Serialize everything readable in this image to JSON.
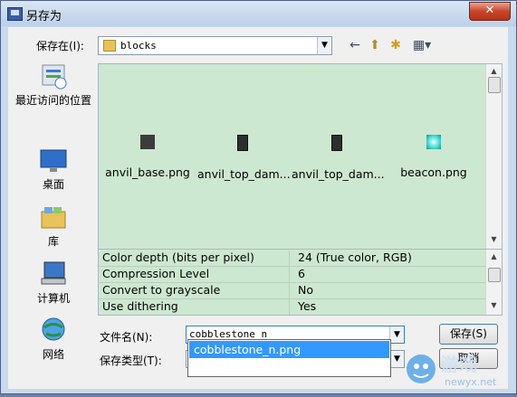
{
  "window": {
    "title": "另存为",
    "close_glyph": "✕"
  },
  "location": {
    "label": "保存在(I):",
    "folder": "blocks"
  },
  "toolbar": {
    "back": "←",
    "up": "⬆",
    "new_folder": "✱",
    "view": "▦▾"
  },
  "places": [
    {
      "label": "最近访问的位置",
      "icon": "recent-places-icon"
    },
    {
      "label": "桌面",
      "icon": "desktop-icon"
    },
    {
      "label": "库",
      "icon": "libraries-icon"
    },
    {
      "label": "计算机",
      "icon": "computer-icon"
    },
    {
      "label": "网络",
      "icon": "network-icon"
    }
  ],
  "files": [
    {
      "name": "anvil_base.png",
      "icon_color": "#3c3c3c"
    },
    {
      "name": "anvil_top_dam...",
      "icon_color": "#2e2e2e"
    },
    {
      "name": "anvil_top_dam...",
      "icon_color": "#2e2e2e"
    },
    {
      "name": "beacon.png",
      "icon_color": "#3fd8d0"
    }
  ],
  "properties": [
    {
      "key": "Color depth (bits per pixel)",
      "value": "24 (True color, RGB)"
    },
    {
      "key": "Compression Level",
      "value": "6"
    },
    {
      "key": "Convert to grayscale",
      "value": "No"
    },
    {
      "key": "Use dithering",
      "value": "Yes"
    }
  ],
  "filename": {
    "label": "文件名(N):",
    "value": "cobblestone_n"
  },
  "filetype": {
    "label": "保存类型(T):",
    "value": ""
  },
  "autocomplete": {
    "suggestion": "cobblestone_n.png"
  },
  "buttons": {
    "save": "保存(S)",
    "cancel": "取消"
  },
  "watermark": {
    "text": "newyx.net"
  },
  "colors": {
    "file_area_bg": "#cde8d0",
    "selection": "#3399ff",
    "close_button": "#c7452c"
  }
}
